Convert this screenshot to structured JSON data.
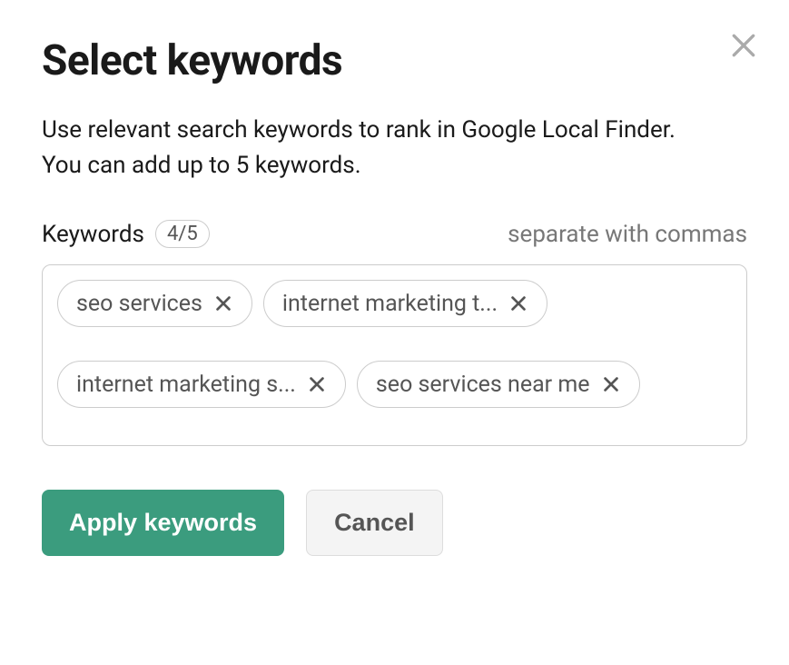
{
  "modal": {
    "title": "Select keywords",
    "description_line1": "Use relevant search keywords to rank in Google Local Finder.",
    "description_line2": "You can add up to 5 keywords.",
    "keywords_label": "Keywords",
    "count_badge": "4/5",
    "hint": "separate with commas",
    "chips": [
      "seo services",
      "internet marketing t...",
      "internet marketing s...",
      "seo services near me"
    ],
    "apply_label": "Apply keywords",
    "cancel_label": "Cancel"
  }
}
